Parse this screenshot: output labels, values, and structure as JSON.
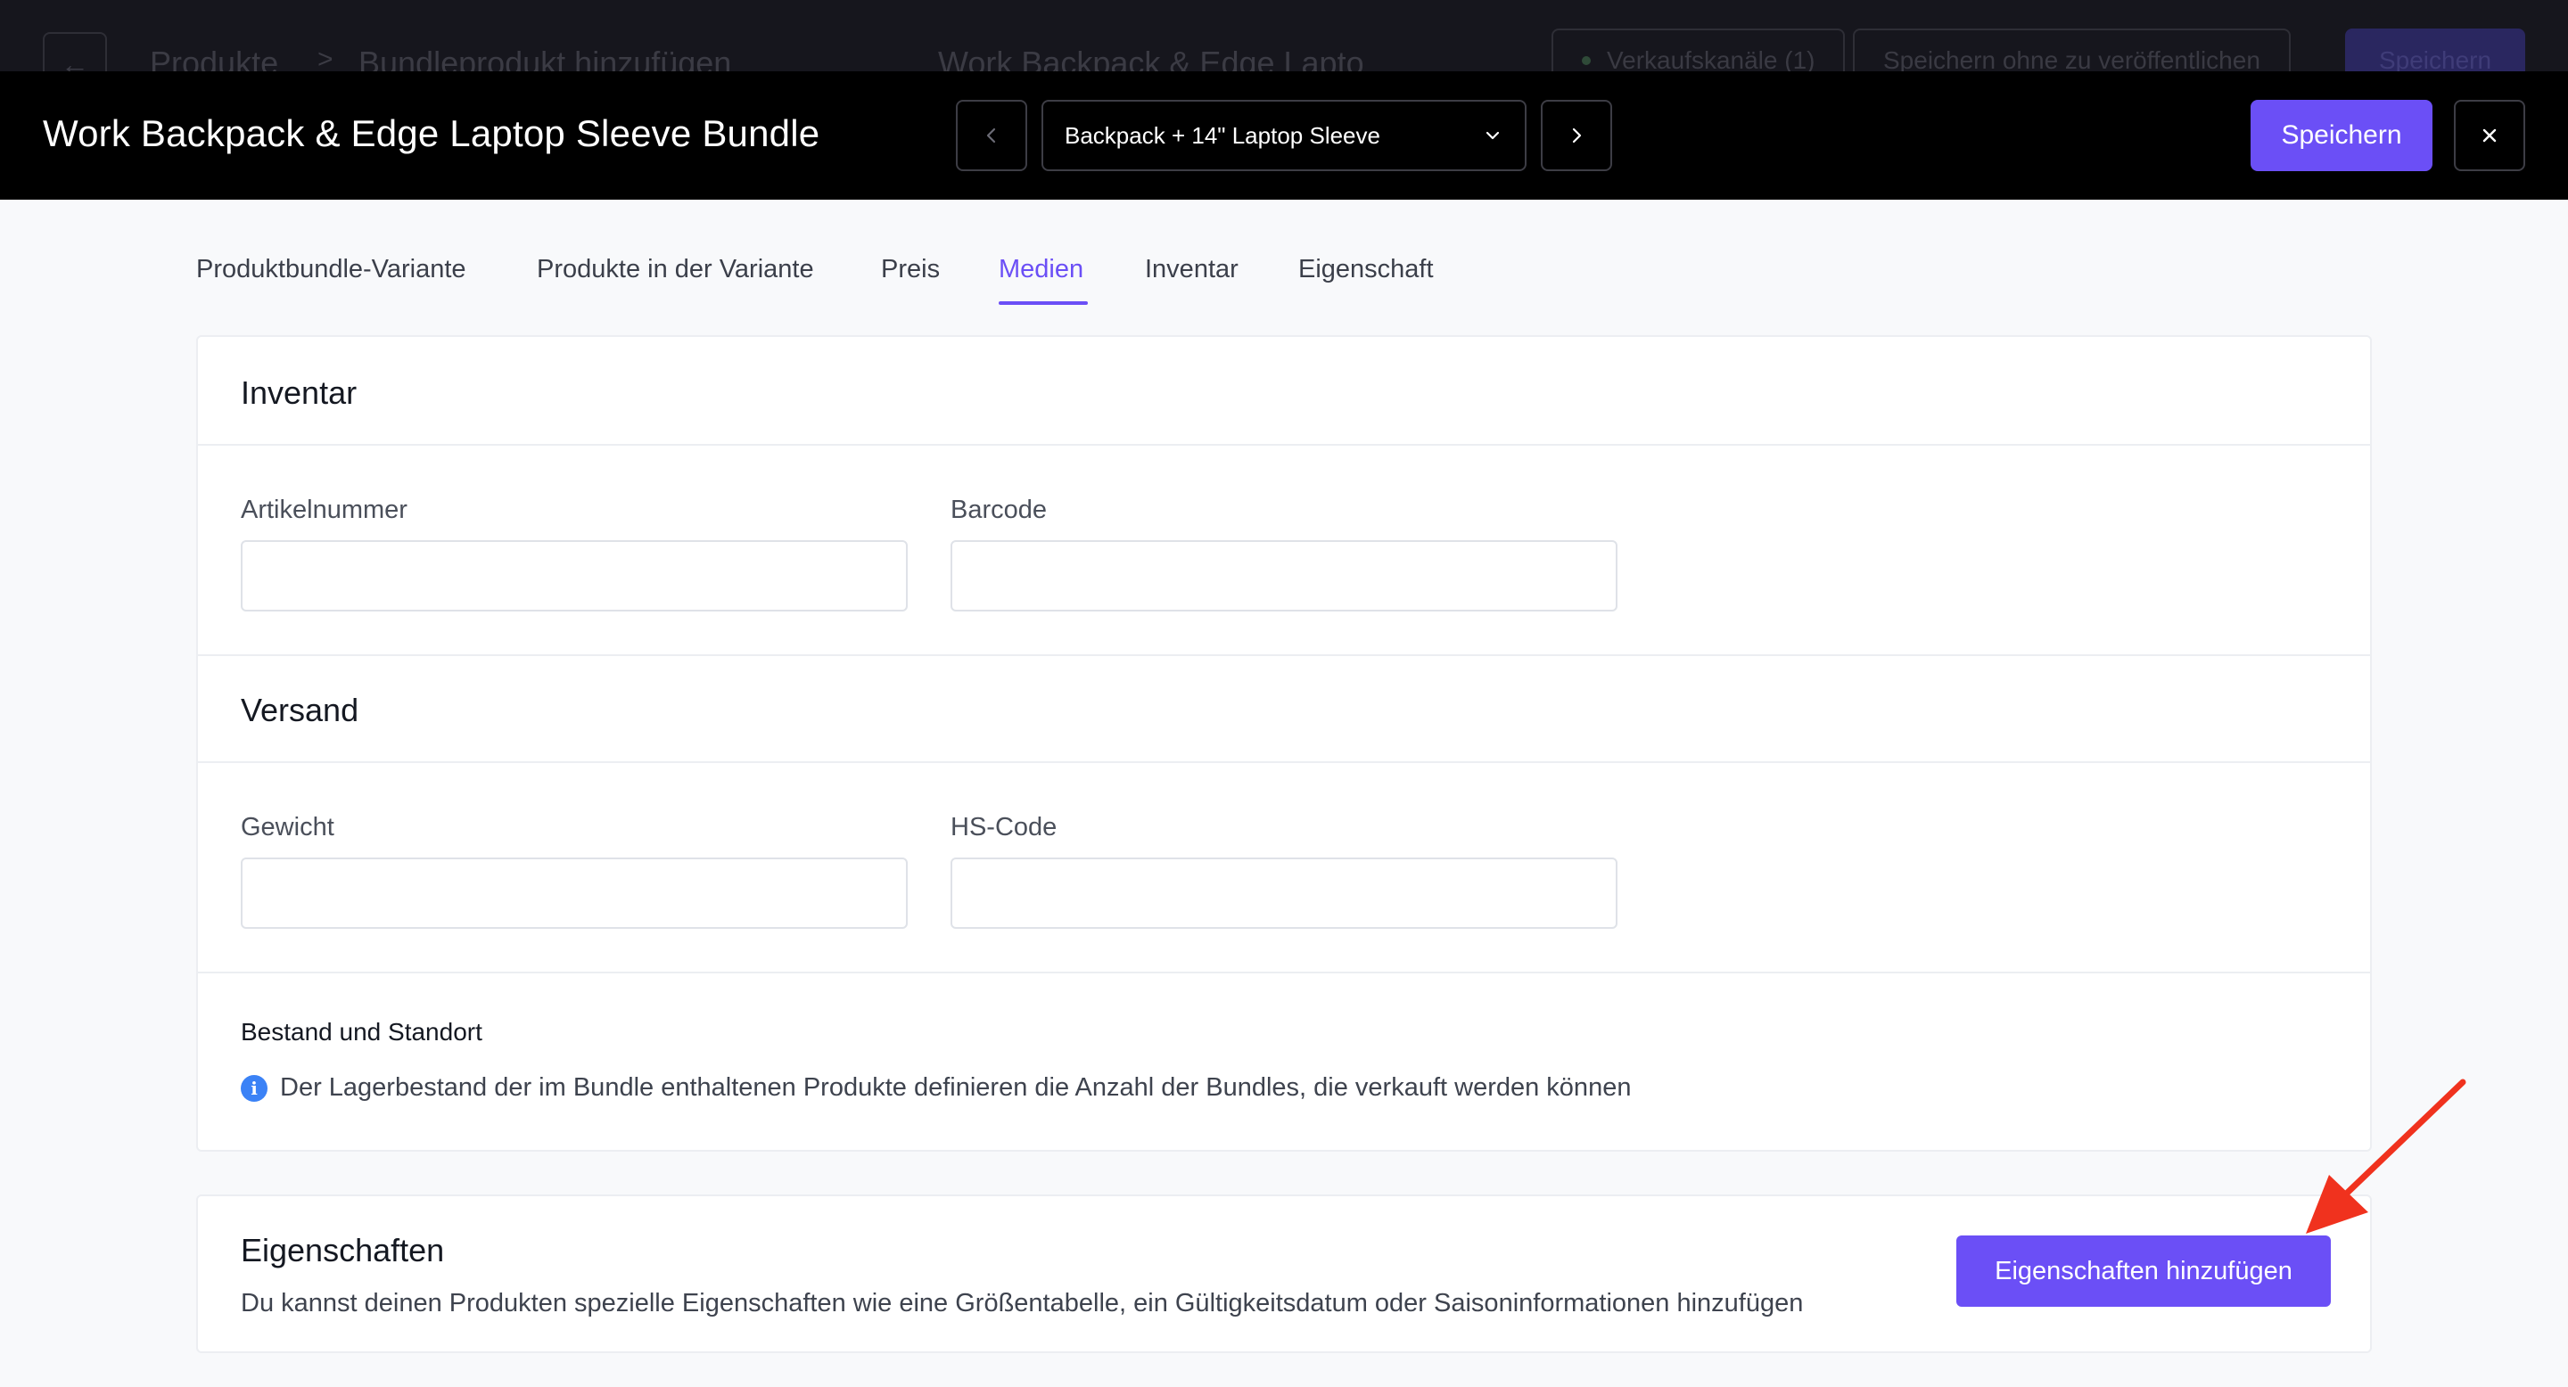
{
  "background": {
    "crumb_parent": "Produkte",
    "crumb_separator": ">",
    "crumb_current": "Bundleprodukt hinzufügen",
    "product_name": "Work Backpack & Edge Lapto",
    "sales_channels": "Verkaufskanäle (1)",
    "save_unpublished": "Speichern ohne zu veröffentlichen",
    "save": "Speichern"
  },
  "modal": {
    "title": "Work Backpack & Edge Laptop Sleeve Bundle",
    "variant_value": "Backpack + 14\" Laptop Sleeve",
    "save_label": "Speichern"
  },
  "tabs": [
    {
      "label": "Produktbundle-Variante"
    },
    {
      "label": "Produkte in der Variante"
    },
    {
      "label": "Preis"
    },
    {
      "label": "Medien"
    },
    {
      "label": "Inventar"
    },
    {
      "label": "Eigenschaft"
    }
  ],
  "active_tab": "Medien",
  "inventory": {
    "title": "Inventar",
    "sku_label": "Artikelnummer",
    "sku_value": "",
    "barcode_label": "Barcode",
    "barcode_value": ""
  },
  "shipping": {
    "title": "Versand",
    "weight_label": "Gewicht",
    "weight_value": "",
    "hs_label": "HS-Code",
    "hs_value": ""
  },
  "stock": {
    "title": "Bestand und Standort",
    "info_text": "Der Lagerbestand der im Bundle enthaltenen Produkte definieren die Anzahl der Bundles, die verkauft werden können"
  },
  "properties": {
    "title": "Eigenschaften",
    "description": "Du kannst deinen Produkten spezielle Eigenschaften wie eine Größentabelle, ein Gültigkeitsdatum oder Saisoninformationen hinzufügen",
    "add_button": "Eigenschaften hinzufügen"
  },
  "colors": {
    "accent": "#6b4ff6",
    "header_bg": "#000000",
    "annotation_arrow": "#f0321e",
    "info_icon": "#3b82f6"
  },
  "icons": [
    "back-arrow-icon",
    "chevron-left-icon",
    "chevron-down-icon",
    "chevron-right-icon",
    "close-icon",
    "info-icon"
  ]
}
